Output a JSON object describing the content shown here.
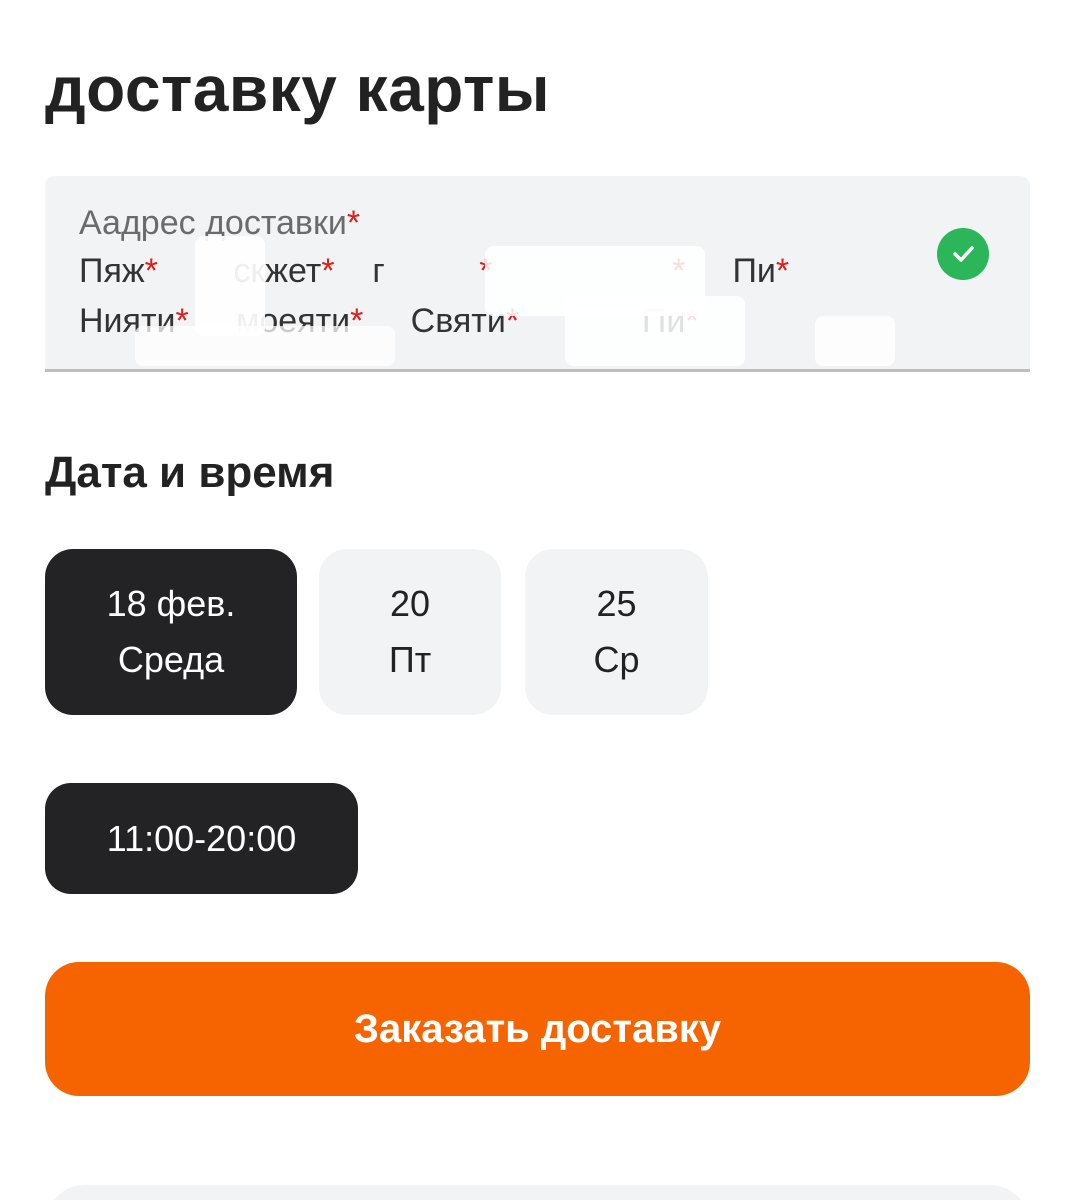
{
  "header": {
    "title": "доставку карты"
  },
  "address": {
    "line1": "Аадрес доставки",
    "line2_a": "Пяж",
    "line2_b": "скжет",
    "line2_c": "г",
    "line2_d": "Пи",
    "line3_a": "Нияти",
    "line3_b": "моеяти",
    "line3_c": "Святи",
    "line3_d": "Пи",
    "required_mark": "*",
    "status_icon": "check-circle-icon",
    "status_color": "#2bb65a"
  },
  "schedule": {
    "title": "Дата и время",
    "dates": [
      {
        "day": "18 фев.",
        "weekday": "Среда",
        "selected": true
      },
      {
        "day": "20",
        "weekday": "Пт",
        "selected": false
      },
      {
        "day": "25",
        "weekday": "Ср",
        "selected": false
      }
    ],
    "time_slot": "11:00-20:00"
  },
  "actions": {
    "order_label": "Заказать доставку",
    "order_color": "#f56400"
  }
}
